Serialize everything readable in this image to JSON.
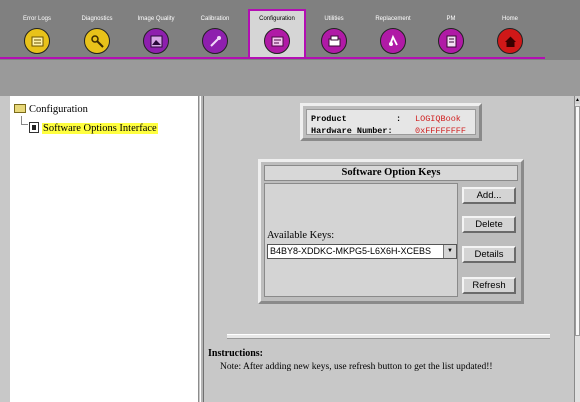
{
  "tabs": [
    {
      "label": "Error Logs",
      "icon": "error-logs-icon",
      "color": "#e8c21a",
      "active": false
    },
    {
      "label": "Diagnostics",
      "icon": "diagnostics-icon",
      "color": "#e8c21a",
      "active": false
    },
    {
      "label": "Image Quality",
      "icon": "image-quality-icon",
      "color": "#8e1fae",
      "active": false
    },
    {
      "label": "Calibration",
      "icon": "calibration-icon",
      "color": "#8e1fae",
      "active": false
    },
    {
      "label": "Configuration",
      "icon": "configuration-icon",
      "color": "#b01aa6",
      "active": true
    },
    {
      "label": "Utilities",
      "icon": "utilities-icon",
      "color": "#b01aa6",
      "active": false
    },
    {
      "label": "Replacement",
      "icon": "replacement-icon",
      "color": "#b01aa6",
      "active": false
    },
    {
      "label": "PM",
      "icon": "pm-icon",
      "color": "#b01aa6",
      "active": false
    },
    {
      "label": "Home",
      "icon": "home-icon",
      "color": "#d01818",
      "active": false
    }
  ],
  "tree": {
    "root_label": "Configuration",
    "child_label": "Software Options Interface"
  },
  "product": {
    "product_label": "Product",
    "product_sep": ":",
    "product_value": "LOGIQBook",
    "hw_label": "Hardware Number:",
    "hw_value": "0xFFFFFFFF"
  },
  "keys_panel": {
    "title": "Software Option Keys",
    "available_label": "Available Keys:",
    "selected_key": "B4BY8-XDDKC-MKPG5-L6X6H-XCEBS",
    "buttons": {
      "add": "Add...",
      "delete": "Delete",
      "details": "Details",
      "refresh": "Refresh"
    }
  },
  "instructions": {
    "title": "Instructions:",
    "note": "Note: After adding new keys, use refresh button to get the list updated!!"
  },
  "colors": {
    "accent": "#b30fb3",
    "value_red": "#d02020",
    "highlight": "#ffff40"
  }
}
